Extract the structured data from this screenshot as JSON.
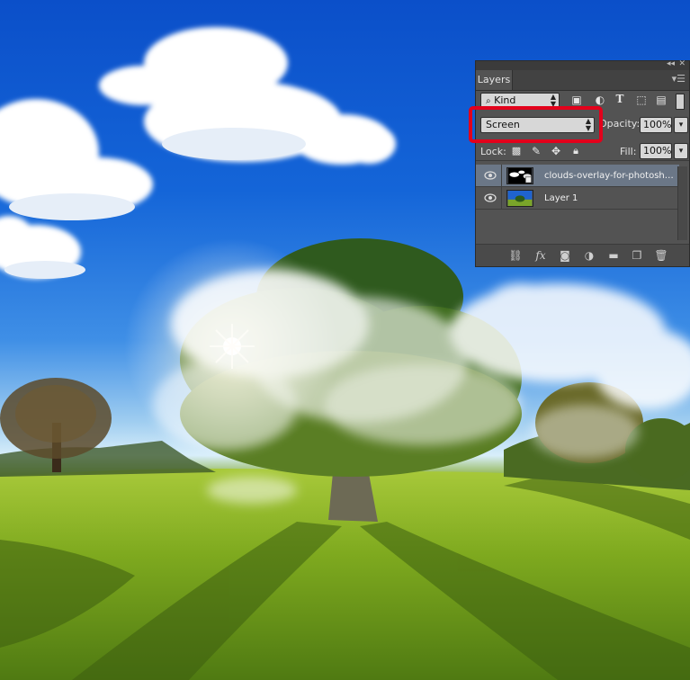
{
  "panel": {
    "tab_label": "Layers",
    "filter": {
      "value": "Kind"
    },
    "blend_mode": {
      "value": "Screen"
    },
    "opacity": {
      "label": "Opacity:",
      "value": "100%"
    },
    "lock_label": "Lock:",
    "fill": {
      "label": "Fill:",
      "value": "100%"
    },
    "layers": [
      {
        "name": "clouds-overlay-for-photosho...",
        "selected": true,
        "visible": true
      },
      {
        "name": "Layer 1",
        "selected": false,
        "visible": true
      }
    ],
    "footer_icons": [
      "link-icon",
      "fx-icon",
      "mask-icon",
      "adjustment-icon",
      "folder-icon",
      "new-layer-icon",
      "trash-icon"
    ]
  },
  "colors": {
    "highlight": "#e3001b",
    "panel_bg": "#535353",
    "selected_row": "#6b7787"
  }
}
